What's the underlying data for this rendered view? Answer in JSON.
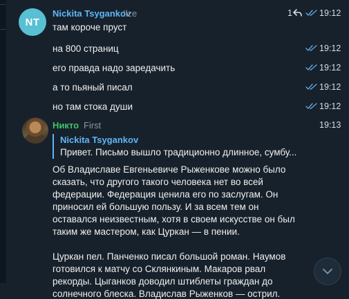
{
  "messages_group_1": {
    "avatar_initials": "NT",
    "avatar_color": "#58c0d3",
    "sender": "Nickita Tsygankov",
    "sender_color": "#5fb7f6",
    "rank": "Ilze",
    "reply_count": "1",
    "reply_icon": "reply-arrow-icon",
    "read_icon": "double-check-icon",
    "messages": [
      {
        "text": "там короче пруст",
        "time": "19:12"
      },
      {
        "text": "на 800 страниц",
        "time": "19:12"
      },
      {
        "text": "его правда надо зaредачить",
        "time": "19:12"
      },
      {
        "text": "а то пьяный писал",
        "time": "19:12"
      },
      {
        "text": "но там стока души",
        "time": "19:12"
      }
    ]
  },
  "messages_group_2": {
    "sender": "Никто",
    "sender_color": "#40c46c",
    "rank": "First",
    "time": "19:13",
    "quote": {
      "name": "Nickita Tsygankov",
      "text": "Привет.  Письмо вышло традиционно длинное, сумбу..."
    },
    "body_lines": [
      "Об Владиславе Евгеньевиче Рыженкове можно было",
      "сказать, что другого такого человека нет во всей",
      "федерации. Федерация ценила его по заслугам. Он",
      "приносил ей большую пользу. И за всем тем он",
      "оставался неизвестным, хотя в своем искусстве он был",
      "таким же мастером, как Цуркан — в пении.",
      "",
      "Цуркан пел. Панченко писал большой роман. Наумов",
      "готовился к матчу со Склянкиным. Макаров рвал",
      "рекорды. Цыганков доводил штиблеты граждан до",
      "солнечного блеска. Владислав Рыженков — острил."
    ]
  },
  "scroll_button": {
    "icon": "chevron-down-icon"
  }
}
